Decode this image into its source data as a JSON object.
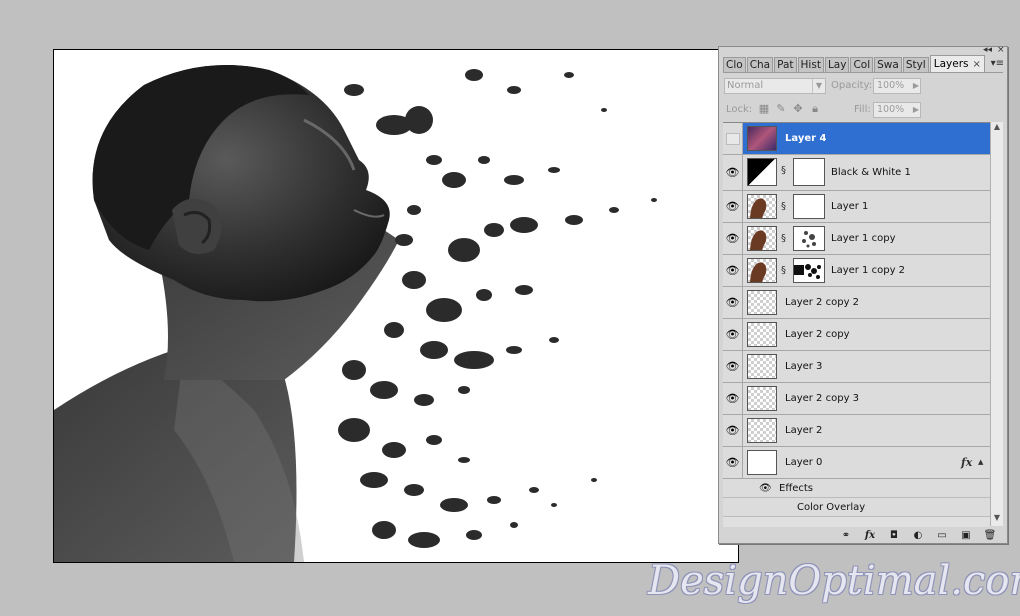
{
  "panel": {
    "tabs": [
      {
        "label": "Clo"
      },
      {
        "label": "Cha"
      },
      {
        "label": "Pat"
      },
      {
        "label": "Hist"
      },
      {
        "label": "Lay"
      },
      {
        "label": "Col"
      },
      {
        "label": "Swa"
      },
      {
        "label": "Styl"
      },
      {
        "label": "Layers",
        "active": true
      }
    ],
    "tab_close": "×",
    "collapse_ctl": "◂◂",
    "close_ctl": "×",
    "menu_ctl": "▾≡",
    "blend_mode": "Normal",
    "opacity_label": "Opacity:",
    "opacity_value": "100%",
    "lock_label": "Lock:",
    "fill_label": "Fill:",
    "fill_value": "100%"
  },
  "layers": [
    {
      "name": "Layer 4",
      "selected": true,
      "visible": false,
      "thumb": "nebula",
      "mask": false
    },
    {
      "name": "Black & White 1",
      "visible": true,
      "thumb": "adjustment",
      "mask": true,
      "mask_type": "white",
      "tall": true
    },
    {
      "name": "Layer 1",
      "visible": true,
      "thumb": "photo",
      "mask": true,
      "mask_type": "white"
    },
    {
      "name": "Layer 1 copy",
      "visible": true,
      "thumb": "photo",
      "mask": true,
      "mask_type": "splatter-light"
    },
    {
      "name": "Layer 1 copy 2",
      "visible": true,
      "thumb": "photo",
      "mask": true,
      "mask_type": "splatter-dark"
    },
    {
      "name": "Layer 2 copy 2",
      "visible": true,
      "thumb": "checker",
      "mask": false
    },
    {
      "name": "Layer 2 copy",
      "visible": true,
      "thumb": "checker",
      "mask": false
    },
    {
      "name": "Layer 3",
      "visible": true,
      "thumb": "checker",
      "mask": false
    },
    {
      "name": "Layer 2 copy 3",
      "visible": true,
      "thumb": "checker",
      "mask": false
    },
    {
      "name": "Layer 2",
      "visible": true,
      "thumb": "checker",
      "mask": false
    },
    {
      "name": "Layer 0",
      "visible": true,
      "thumb": "white",
      "mask": false,
      "fx": "fx"
    }
  ],
  "effects": {
    "label": "Effects",
    "items": [
      "Color Overlay"
    ]
  },
  "bottom_icons": [
    "link-icon",
    "fx-icon",
    "mask-icon",
    "adjustment-icon",
    "folder-icon",
    "new-layer-icon",
    "trash-icon"
  ],
  "bottom_labels": {
    "fx": "fx"
  },
  "watermark": "DesignOptimal.com",
  "colors": {
    "selection": "#2f6fd1",
    "workspace": "#c0c0c0",
    "panel": "#d4d4d4"
  }
}
